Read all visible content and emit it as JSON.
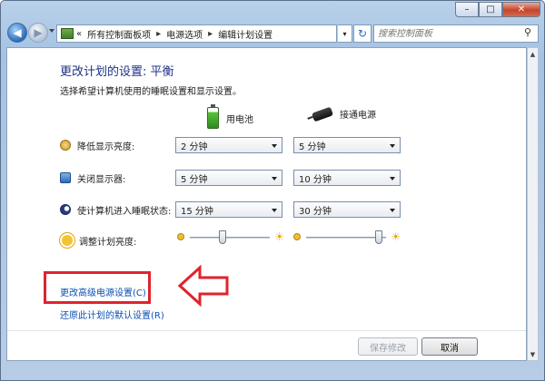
{
  "address": {
    "chevron": "«",
    "crumbs": [
      "所有控制面板项",
      "电源选项",
      "编辑计划设置"
    ],
    "sep": "▸",
    "dropdown": "▾",
    "refresh": "↻"
  },
  "search": {
    "placeholder": "搜索控制面板",
    "icon": "search-icon"
  },
  "window": {
    "minimize": "–",
    "maximize": "□",
    "close": "✕"
  },
  "page": {
    "title": "更改计划的设置: 平衡",
    "subtitle": "选择希望计算机使用的睡眠设置和显示设置。"
  },
  "columns": {
    "battery": "用电池",
    "plugged": "接通电源"
  },
  "settings": [
    {
      "label": "降低显示亮度:",
      "battery": "2 分钟",
      "plugged": "5 分钟",
      "icon": "dim-icon"
    },
    {
      "label": "关闭显示器:",
      "battery": "5 分钟",
      "plugged": "10 分钟",
      "icon": "monitor-icon"
    },
    {
      "label": "使计算机进入睡眠状态:",
      "battery": "15 分钟",
      "plugged": "30 分钟",
      "icon": "sleep-icon"
    }
  ],
  "brightness": {
    "label": "调整计划亮度:",
    "battery_level": 0.4,
    "plugged_level": 0.95,
    "icon": "sun-icon"
  },
  "links": {
    "advanced": "更改高级电源设置(C)",
    "restore": "还原此计划的默认设置(R)"
  },
  "buttons": {
    "save": "保存修改",
    "cancel": "取消"
  },
  "colors": {
    "title": "#1e3287",
    "link": "#0b4fb3",
    "highlight": "#e0232c"
  }
}
